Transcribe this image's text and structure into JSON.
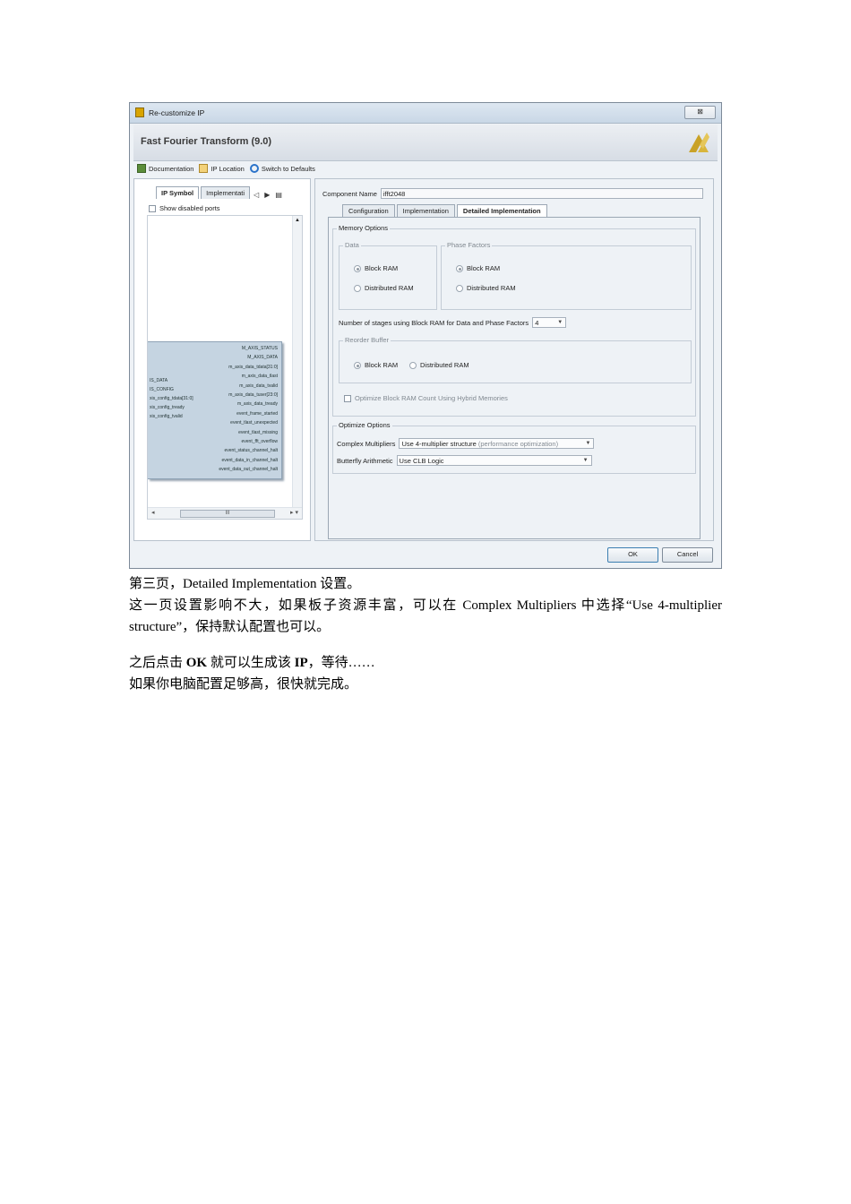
{
  "window": {
    "title": "Re-customize IP",
    "close_symbol": "⊠",
    "header_title": "Fast Fourier Transform (9.0)",
    "logo_icon": "xilinx-logo-icon"
  },
  "toolbar": {
    "documentation": "Documentation",
    "ip_location": "IP Location",
    "switch_defaults": "Switch to Defaults"
  },
  "left_panel": {
    "tabs": [
      "IP Symbol",
      "Implementati"
    ],
    "show_disabled_ports": "Show disabled ports",
    "hscroll_thumb": "III",
    "ports_right": [
      "M_AXIS_STATUS",
      "M_AXIS_DATA",
      "m_axis_data_tdata[31:0]",
      "m_axis_data_tlast",
      "m_axis_data_tvalid",
      "m_axis_data_tuser[23:0]",
      "m_axis_data_tready",
      "event_frame_started",
      "event_tlast_unexpected",
      "event_tlast_missing",
      "event_fft_overflow",
      "event_status_channel_halt",
      "event_data_in_channel_halt",
      "event_data_out_channel_halt"
    ],
    "ports_left": [
      "IS_DATA",
      "IS_CONFIG",
      "xis_config_tdata[31:0]",
      "xis_config_tready",
      "xis_config_tvalid"
    ]
  },
  "right_panel": {
    "component_name_label": "Component Name",
    "component_name_value": "ifft2048",
    "tabs": [
      "Configuration",
      "Implementation",
      "Detailed Implementation"
    ],
    "memory_options": {
      "title": "Memory Options",
      "data": {
        "title": "Data",
        "block_ram": "Block RAM",
        "distributed_ram": "Distributed RAM"
      },
      "phase_factors": {
        "title": "Phase Factors",
        "block_ram": "Block RAM",
        "distributed_ram": "Distributed RAM"
      },
      "stages_label": "Number of stages using Block RAM for Data and Phase Factors",
      "stages_value": "4",
      "reorder_buffer": {
        "title": "Reorder Buffer",
        "block_ram": "Block RAM",
        "distributed_ram": "Distributed RAM"
      },
      "hybrid_label": "Optimize Block RAM Count Using Hybrid Memories"
    },
    "optimize_options": {
      "title": "Optimize Options",
      "complex_multipliers_label": "Complex Multipliers",
      "complex_multipliers_value": "Use 4-multiplier structure",
      "complex_multipliers_hint": "(performance optimization)",
      "butterfly_label": "Butterfly Arithmetic",
      "butterfly_value": "Use CLB Logic"
    }
  },
  "buttons": {
    "ok": "OK",
    "cancel": "Cancel"
  },
  "doc": {
    "line1": "第三页，Detailed Implementation 设置。",
    "line2": "这一页设置影响不大，如果板子资源丰富，可以在 Complex Multipliers 中选择“Use 4-multiplier structure”，保持默认配置也可以。",
    "line3_pre": "之后点击 ",
    "line3_ok": "OK",
    "line3_mid": " 就可以生成该 ",
    "line3_ip": "IP",
    "line3_post": "，等待……",
    "line4": "如果你电脑配置足够高，很快就完成。"
  }
}
